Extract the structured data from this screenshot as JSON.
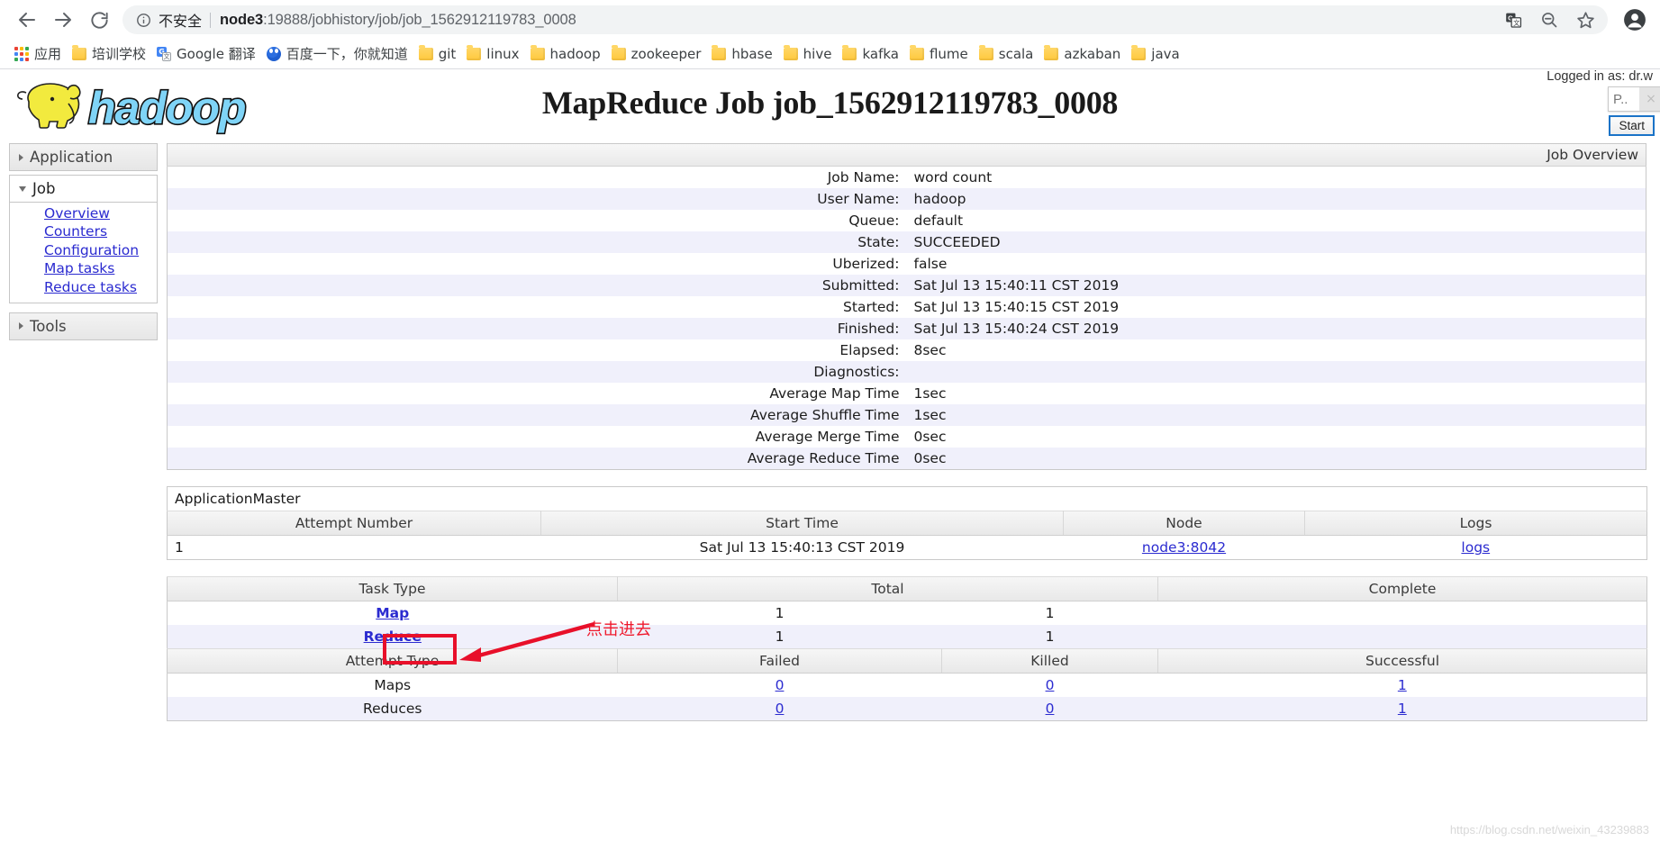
{
  "browser": {
    "back_label": "Back",
    "forward_label": "Forward",
    "reload_label": "Reload",
    "security_text": "不安全",
    "url_host": "node3",
    "url_rest": ":19888/jobhistory/job/job_1562912119783_0008",
    "translate_label": "Translate",
    "zoom_out_label": "Zoom out",
    "bookmark_label": "Bookmark this page",
    "profile_label": "Profile",
    "bookmarks": [
      {
        "label": "应用",
        "icon": "apps-grid-icon"
      },
      {
        "label": "培训学校",
        "icon": "folder-icon"
      },
      {
        "label": "Google 翻译",
        "icon": "google-translate-icon"
      },
      {
        "label": "百度一下，你就知道",
        "icon": "baidu-icon"
      },
      {
        "label": "git",
        "icon": "folder-icon"
      },
      {
        "label": "linux",
        "icon": "folder-icon"
      },
      {
        "label": "hadoop",
        "icon": "folder-icon"
      },
      {
        "label": "zookeeper",
        "icon": "folder-icon"
      },
      {
        "label": "hbase",
        "icon": "folder-icon"
      },
      {
        "label": "hive",
        "icon": "folder-icon"
      },
      {
        "label": "kafka",
        "icon": "folder-icon"
      },
      {
        "label": "flume",
        "icon": "folder-icon"
      },
      {
        "label": "scala",
        "icon": "folder-icon"
      },
      {
        "label": "azkaban",
        "icon": "folder-icon"
      },
      {
        "label": "java",
        "icon": "folder-icon"
      }
    ]
  },
  "header": {
    "logo_alt": "hadoop",
    "title": "MapReduce Job job_1562912119783_0008",
    "logged_in": "Logged in as: dr.w",
    "search_value": "P..",
    "search_clear": "×",
    "start_button": "Start"
  },
  "sidebar": {
    "application": {
      "label": "Application",
      "expanded": false
    },
    "job": {
      "label": "Job",
      "expanded": true,
      "items": [
        {
          "label": "Overview"
        },
        {
          "label": "Counters"
        },
        {
          "label": "Configuration"
        },
        {
          "label": "Map tasks"
        },
        {
          "label": "Reduce tasks"
        }
      ]
    },
    "tools": {
      "label": "Tools",
      "expanded": false
    }
  },
  "overview": {
    "band_title": "Job Overview",
    "rows": [
      {
        "key": "Job Name:",
        "value": "word count"
      },
      {
        "key": "User Name:",
        "value": "hadoop"
      },
      {
        "key": "Queue:",
        "value": "default"
      },
      {
        "key": "State:",
        "value": "SUCCEEDED"
      },
      {
        "key": "Uberized:",
        "value": "false"
      },
      {
        "key": "Submitted:",
        "value": "Sat Jul 13 15:40:11 CST 2019"
      },
      {
        "key": "Started:",
        "value": "Sat Jul 13 15:40:15 CST 2019"
      },
      {
        "key": "Finished:",
        "value": "Sat Jul 13 15:40:24 CST 2019"
      },
      {
        "key": "Elapsed:",
        "value": "8sec"
      },
      {
        "key": "Diagnostics:",
        "value": ""
      },
      {
        "key": "Average Map Time",
        "value": "1sec"
      },
      {
        "key": "Average Shuffle Time",
        "value": "1sec"
      },
      {
        "key": "Average Merge Time",
        "value": "0sec"
      },
      {
        "key": "Average Reduce Time",
        "value": "0sec"
      }
    ]
  },
  "app_master": {
    "title": "ApplicationMaster",
    "columns": [
      "Attempt Number",
      "Start Time",
      "Node",
      "Logs"
    ],
    "rows": [
      {
        "attempt": "1",
        "start_time": "Sat Jul 13 15:40:13 CST 2019",
        "node": "node3:8042",
        "logs": "logs"
      }
    ]
  },
  "tasks": {
    "columns": [
      "Task Type",
      "Total",
      "Complete"
    ],
    "rows": [
      {
        "type": "Map",
        "total": "1",
        "complete": "1"
      },
      {
        "type": "Reduce",
        "total": "1",
        "complete": "1"
      }
    ]
  },
  "attempts": {
    "columns": [
      "Attempt Type",
      "Failed",
      "Killed",
      "Successful"
    ],
    "rows": [
      {
        "type": "Maps",
        "failed": "0",
        "killed": "0",
        "successful": "1"
      },
      {
        "type": "Reduces",
        "failed": "0",
        "killed": "0",
        "successful": "1"
      }
    ]
  },
  "annotation": {
    "text": "点击进去"
  },
  "watermark": "https://blog.csdn.net/weixin_43239883"
}
